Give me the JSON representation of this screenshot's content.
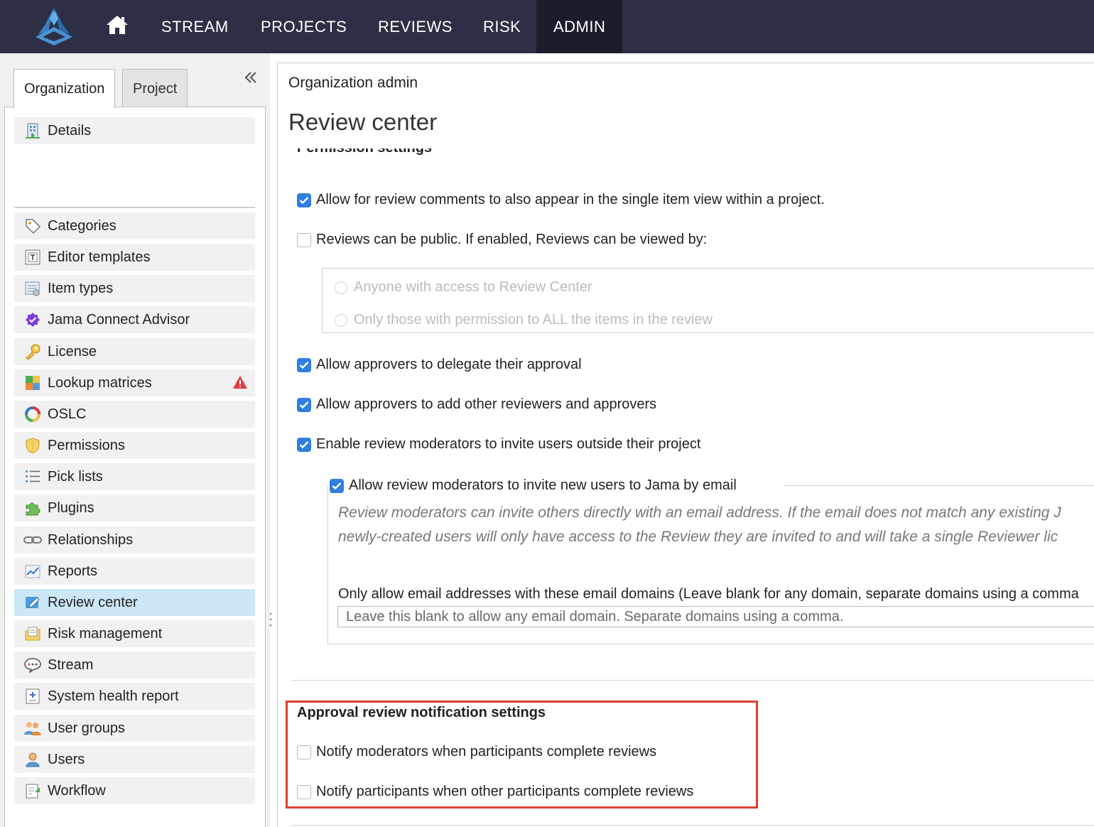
{
  "nav": {
    "items": [
      {
        "label": "STREAM"
      },
      {
        "label": "PROJECTS"
      },
      {
        "label": "REVIEWS"
      },
      {
        "label": "RISK"
      },
      {
        "label": "ADMIN",
        "active": true
      }
    ]
  },
  "sidebar": {
    "tabs": [
      {
        "label": "Organization",
        "active": true
      },
      {
        "label": "Project",
        "active": false
      }
    ],
    "items": [
      {
        "label": "Details",
        "icon": "building-icon"
      },
      {
        "label": "Categories",
        "icon": "tag-icon"
      },
      {
        "label": "Editor templates",
        "icon": "template-icon"
      },
      {
        "label": "Item types",
        "icon": "item-types-icon"
      },
      {
        "label": "Jama Connect Advisor",
        "icon": "advisor-badge-icon"
      },
      {
        "label": "License",
        "icon": "key-icon"
      },
      {
        "label": "Lookup matrices",
        "icon": "matrix-icon",
        "warning": true
      },
      {
        "label": "OSLC",
        "icon": "oslc-icon"
      },
      {
        "label": "Permissions",
        "icon": "shield-icon"
      },
      {
        "label": "Pick lists",
        "icon": "list-icon"
      },
      {
        "label": "Plugins",
        "icon": "puzzle-icon"
      },
      {
        "label": "Relationships",
        "icon": "link-icon"
      },
      {
        "label": "Reports",
        "icon": "chart-icon"
      },
      {
        "label": "Review center",
        "icon": "review-icon",
        "selected": true
      },
      {
        "label": "Risk management",
        "icon": "risk-icon"
      },
      {
        "label": "Stream",
        "icon": "chat-icon"
      },
      {
        "label": "System health report",
        "icon": "health-report-icon"
      },
      {
        "label": "User groups",
        "icon": "user-groups-icon"
      },
      {
        "label": "Users",
        "icon": "user-icon"
      },
      {
        "label": "Workflow",
        "icon": "workflow-icon"
      }
    ]
  },
  "main": {
    "breadcrumb": "Organization admin",
    "title": "Review center",
    "cut_heading": "Permission settings",
    "options": {
      "single_item_comments": {
        "label": "Allow for review comments to also appear in the single item view within a project.",
        "checked": true
      },
      "public_reviews": {
        "label": "Reviews can be public. If enabled, Reviews can be viewed by:",
        "checked": false
      },
      "radio_anyone": {
        "label": "Anyone with access to Review Center"
      },
      "radio_permission": {
        "label": "Only those with permission to ALL the items in the review"
      },
      "delegate": {
        "label": "Allow approvers to delegate their approval",
        "checked": true
      },
      "add_reviewers": {
        "label": "Allow approvers to add other reviewers and approvers",
        "checked": true
      },
      "invite_outside": {
        "label": "Enable review moderators to invite users outside their project",
        "checked": true
      },
      "invite_email": {
        "label": "Allow review moderators to invite new users to Jama by email",
        "checked": true
      }
    },
    "invite_help_line1": "Review moderators can invite others directly with an email address. If the email does not match any existing J",
    "invite_help_line2": "newly-created users will only have access to the Review they are invited to and will take a single Reviewer lic",
    "domains_label": "Only allow email addresses with these email domains (Leave blank for any domain, separate domains using a comma",
    "domains_placeholder": "Leave this blank to allow any email domain. Separate domains using a comma.",
    "notification_title": "Approval review notification settings",
    "notify_moderators": {
      "label": "Notify moderators when participants complete reviews",
      "checked": false
    },
    "notify_participants": {
      "label": "Notify participants when other participants complete reviews",
      "checked": false
    }
  },
  "colors": {
    "topbar": "#2d2f46",
    "checkbox": "#2f7fe0",
    "selected": "#cce8f6",
    "highlight": "#d9402c"
  }
}
